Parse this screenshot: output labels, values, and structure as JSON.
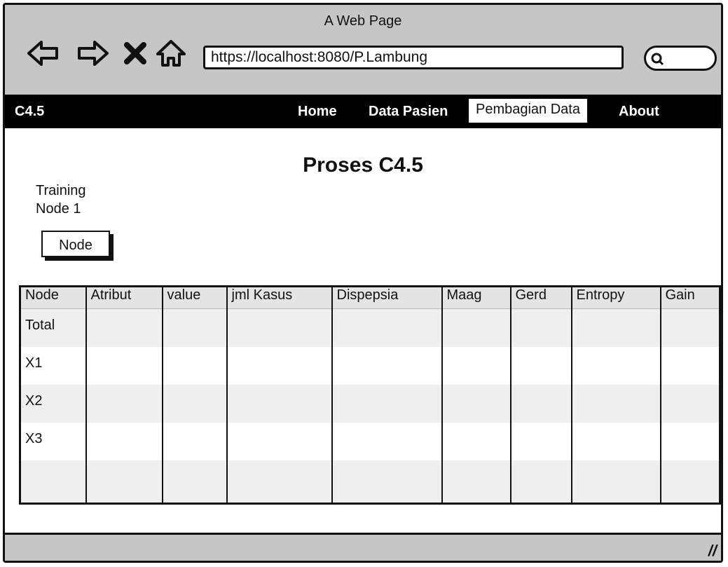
{
  "window": {
    "title": "A Web Page"
  },
  "browser": {
    "url": "https://localhost:8080/P.Lambung",
    "icons": [
      "back-arrow-icon",
      "forward-arrow-icon",
      "close-x-icon",
      "home-icon",
      "search-icon"
    ]
  },
  "navbar": {
    "brand": "C4.5",
    "items": [
      {
        "label": "Home",
        "active": false
      },
      {
        "label": "Data Pasien",
        "active": false
      },
      {
        "label": "Pembagian Data",
        "active": true
      },
      {
        "label": "About",
        "active": false
      }
    ]
  },
  "page": {
    "title": "Proses C4.5",
    "subtitle_line1": "Training",
    "subtitle_line2": "Node 1",
    "node_button": "Node"
  },
  "table": {
    "headers": [
      "Node",
      "Atribut",
      "value",
      "jml Kasus",
      "Dispepsia",
      "Maag",
      "Gerd",
      "Entropy",
      "Gain"
    ],
    "rows": [
      [
        "Total",
        "",
        "",
        "",
        "",
        "",
        "",
        "",
        ""
      ],
      [
        "X1",
        "",
        "",
        "",
        "",
        "",
        "",
        "",
        ""
      ],
      [
        "X2",
        "",
        "",
        "",
        "",
        "",
        "",
        "",
        ""
      ],
      [
        "X3",
        "",
        "",
        "",
        "",
        "",
        "",
        "",
        ""
      ],
      [
        "",
        "",
        "",
        "",
        "",
        "",
        "",
        "",
        ""
      ]
    ]
  },
  "colors": {
    "chrome": "#c6c6c6",
    "navbar": "#000000",
    "stripe": "#efefef"
  }
}
